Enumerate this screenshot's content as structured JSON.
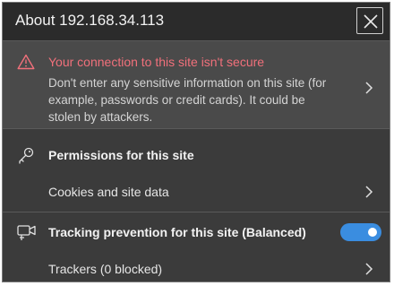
{
  "panel": {
    "title": "About 192.168.34.113"
  },
  "warning": {
    "title": "Your connection to this site isn't secure",
    "body": "Don't enter any sensitive information on this site (for example, passwords or credit cards). It could be stolen by attackers.",
    "color": "#f1707b"
  },
  "permissions": {
    "label": "Permissions for this site",
    "cookies_label": "Cookies and site data"
  },
  "tracking": {
    "label": "Tracking prevention for this site (Balanced)",
    "enabled": true,
    "trackers_label": "Trackers (0 blocked)",
    "toggle_color": "#3a8de0"
  }
}
